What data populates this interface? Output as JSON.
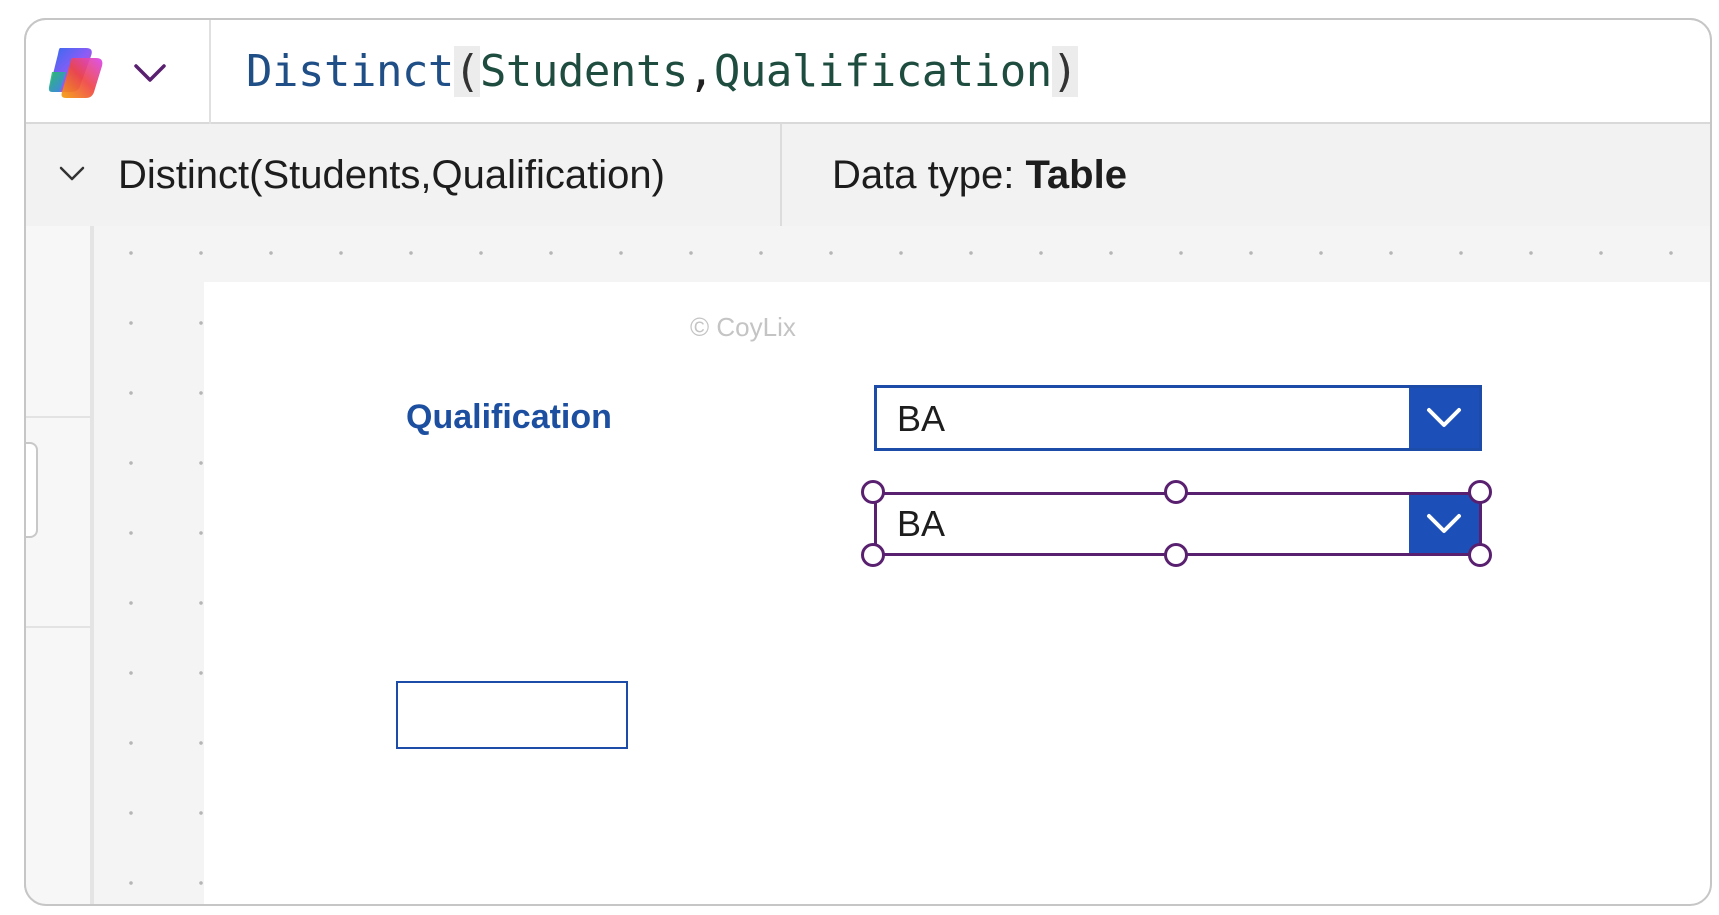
{
  "formula_bar": {
    "copilot_icon": "copilot-icon",
    "chevron_icon": "chevron-down-icon",
    "formula": {
      "function": "Distinct",
      "open_paren": "(",
      "arg1": "Students",
      "comma": ",",
      "arg2": "Qualification",
      "close_paren": ")"
    }
  },
  "result_bar": {
    "expression": "Distinct(Students,Qualification)",
    "data_type_label": "Data type: ",
    "data_type_value": "Table"
  },
  "canvas": {
    "watermark": "© CoyLix",
    "qualification_label": "Qualification",
    "dropdown_1": {
      "value": "BA"
    },
    "dropdown_2": {
      "value": "BA"
    },
    "textbox": {
      "value": ""
    }
  },
  "colors": {
    "accent": "#1d4fb8",
    "label": "#1d4fa0",
    "selection": "#5a2070"
  }
}
